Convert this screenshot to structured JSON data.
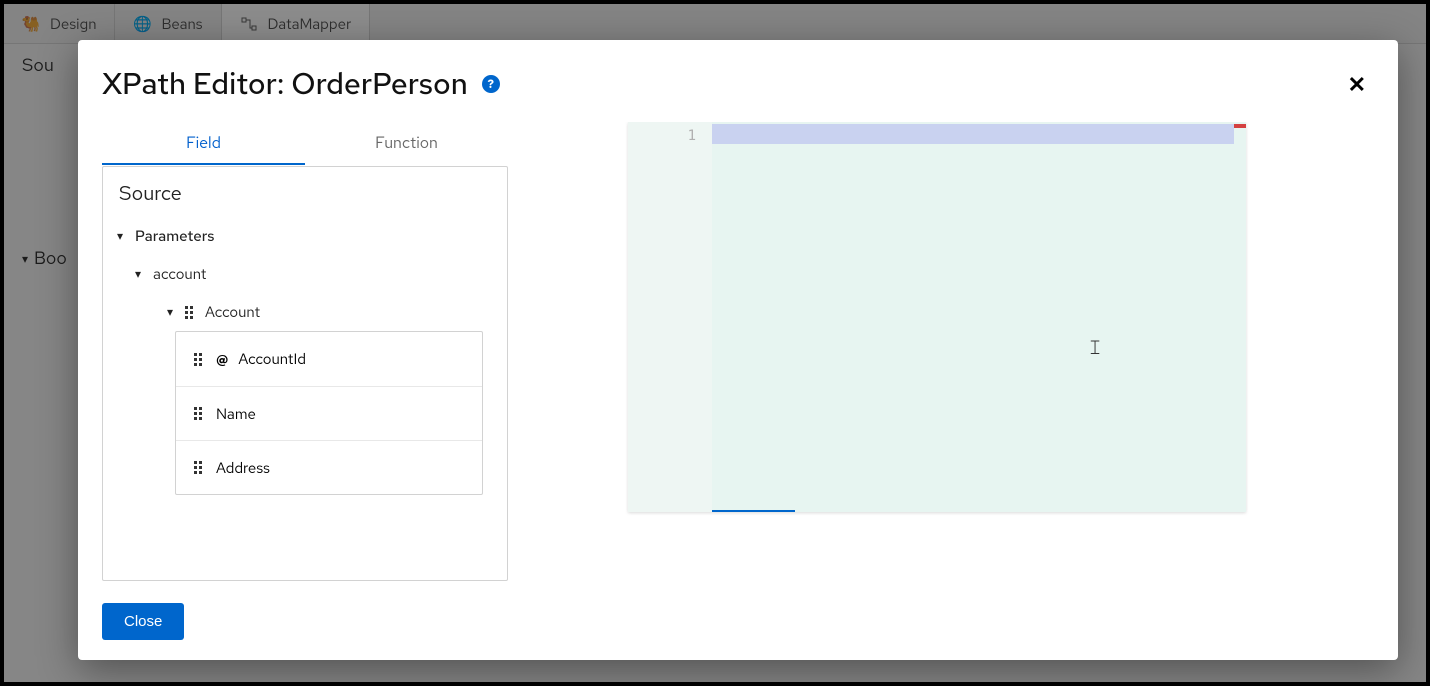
{
  "bg": {
    "tabs": [
      {
        "label": "Design"
      },
      {
        "label": "Beans"
      },
      {
        "label": "DataMapper"
      }
    ],
    "side1": "Sou",
    "side2": "Boo"
  },
  "modal": {
    "title": "XPath Editor: OrderPerson",
    "help_tooltip": "?",
    "close_label": "✕",
    "tabs": {
      "field": "Field",
      "function": "Function"
    },
    "source_title": "Source",
    "footer": {
      "close": "Close"
    }
  },
  "tree": {
    "root": "Parameters",
    "l1": "account",
    "l2": "Account",
    "leaves": [
      "AccountId",
      "Name",
      "Address"
    ]
  },
  "editor": {
    "line_number": "1"
  }
}
